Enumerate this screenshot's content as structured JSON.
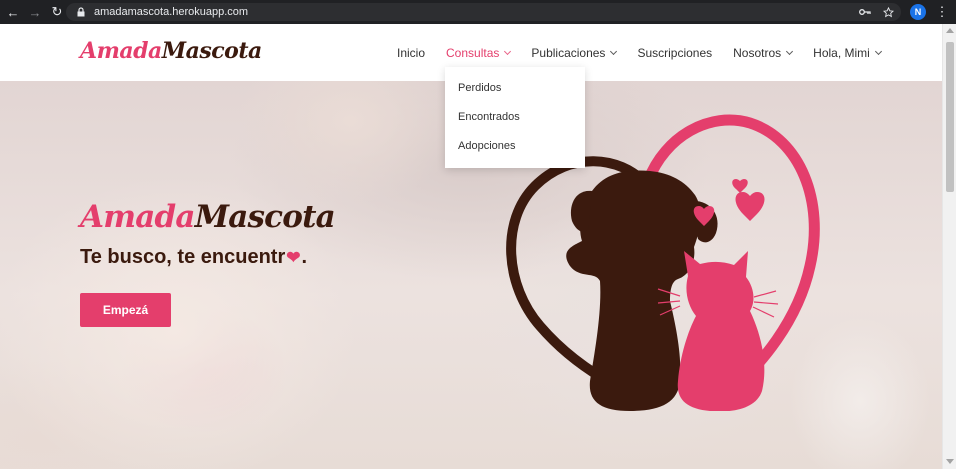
{
  "browser": {
    "url": "amadamascota.herokuapp.com",
    "avatar_initial": "N"
  },
  "brand": {
    "logo_part1": "Amada",
    "logo_part2": "Mascota",
    "accent": "#e43e6c",
    "dark": "#3b1a0e"
  },
  "nav": {
    "items": [
      {
        "label": "Inicio",
        "has_dropdown": false,
        "active": false
      },
      {
        "label": "Consultas",
        "has_dropdown": true,
        "active": true
      },
      {
        "label": "Publicaciones",
        "has_dropdown": true,
        "active": false
      },
      {
        "label": "Suscripciones",
        "has_dropdown": false,
        "active": false
      },
      {
        "label": "Nosotros",
        "has_dropdown": true,
        "active": false
      },
      {
        "label": "Hola, Mimi",
        "has_dropdown": true,
        "active": false
      }
    ],
    "dropdown": [
      "Perdidos",
      "Encontrados",
      "Adopciones"
    ]
  },
  "hero": {
    "title_part1": "Amada",
    "title_part2": "Mascota",
    "tagline_before": "Te busco, te encuentr",
    "tagline_after": ".",
    "cta_label": "Empezá"
  }
}
